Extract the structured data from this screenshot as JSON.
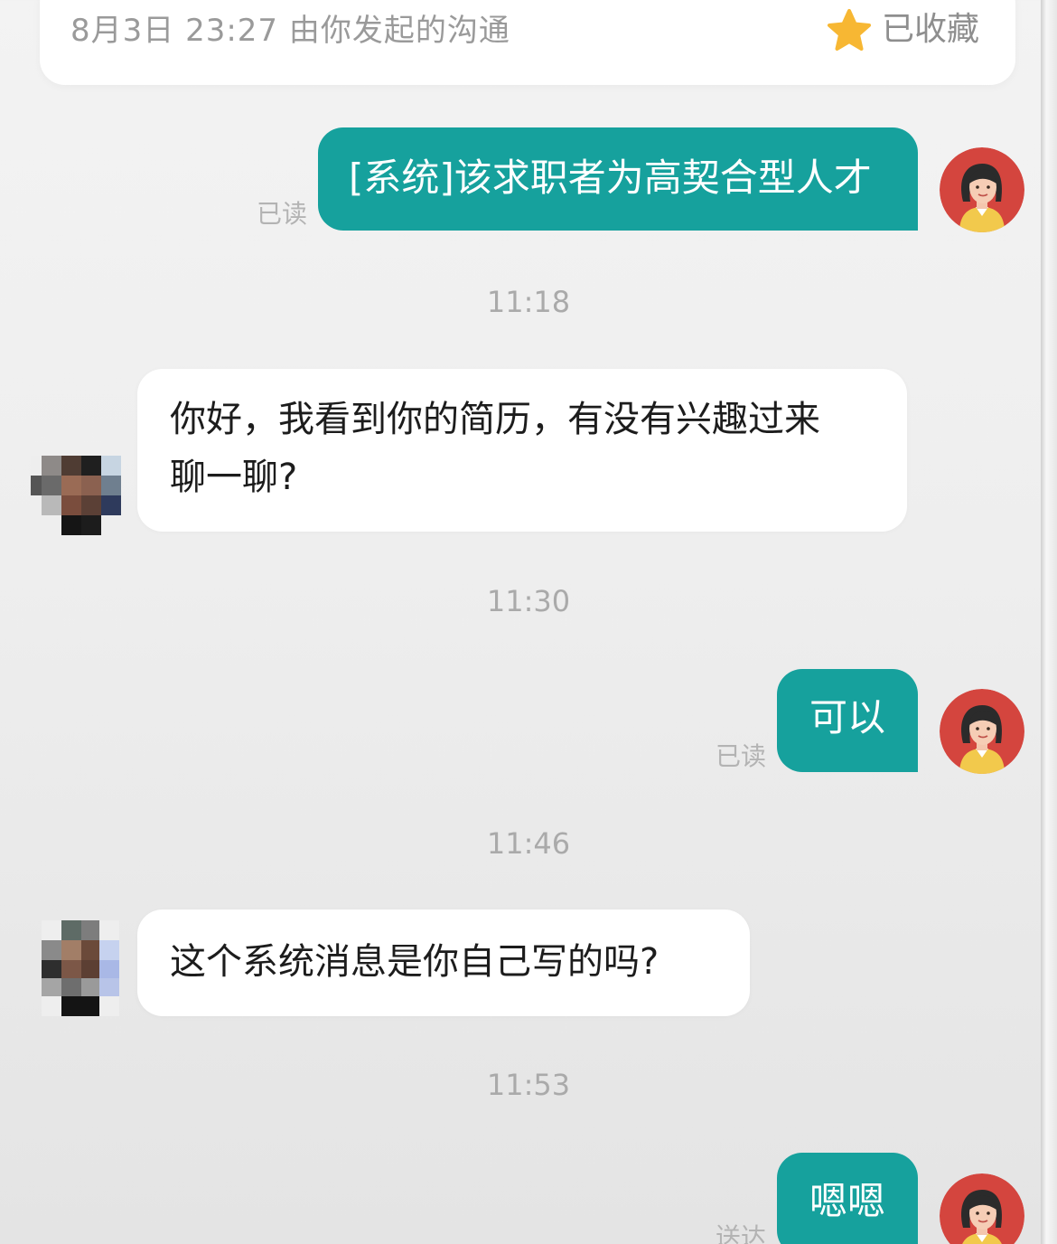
{
  "header": {
    "info": "8月3日 23:27 由你发起的沟通",
    "favorite_label": "已收藏",
    "favorite_icon": "star-icon"
  },
  "colors": {
    "outgoing_bubble": "#16a19d",
    "incoming_bubble": "#ffffff",
    "star": "#f7b733"
  },
  "messages": [
    {
      "from": "self",
      "text": "[系统]该求职者为高契合型人才",
      "status": "已读"
    },
    {
      "timestamp": "11:18"
    },
    {
      "from": "other",
      "text_line1": "你好，我看到你的简历，有没有兴趣过来",
      "text_line2": "聊一聊?"
    },
    {
      "timestamp": "11:30"
    },
    {
      "from": "self",
      "text": "可以",
      "status": "已读"
    },
    {
      "timestamp": "11:46"
    },
    {
      "from": "other",
      "text": "这个系统消息是你自己写的吗?"
    },
    {
      "timestamp": "11:53"
    },
    {
      "from": "self",
      "text": "嗯嗯",
      "status": "送达"
    }
  ]
}
